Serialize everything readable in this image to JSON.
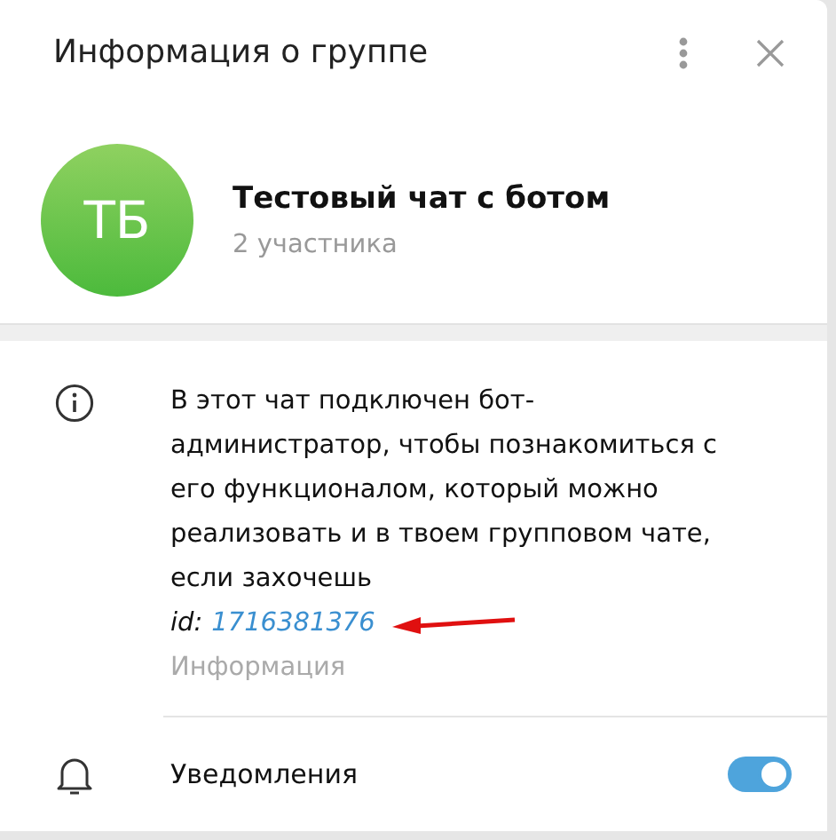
{
  "header": {
    "title": "Информация о группе"
  },
  "group": {
    "initials": "ТБ",
    "name": "Тестовый чат с ботом",
    "members": "2 участника"
  },
  "info": {
    "description": "В этот чат подключен бот-администратор, чтобы познакомиться с его функционалом, который можно реализовать и в твоем групповом чате, если захочешь",
    "id_label": "id:",
    "id_value": "1716381376",
    "caption": "Информация"
  },
  "notifications": {
    "label": "Уведомления",
    "on": true
  }
}
